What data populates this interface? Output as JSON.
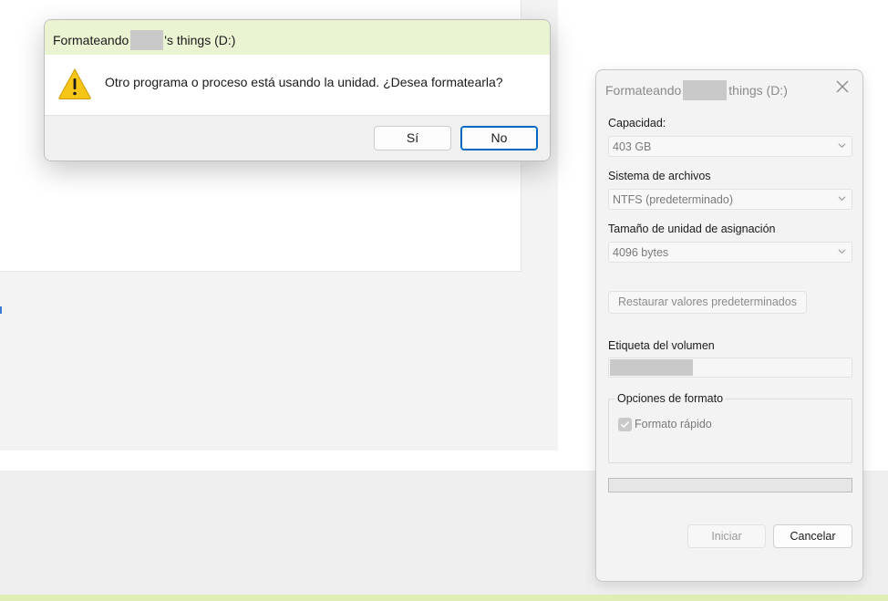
{
  "confirm_dialog": {
    "title_prefix": "Formateando",
    "title_suffix": "'s things (D:)",
    "message": "Otro programa o proceso está usando la unidad. ¿Desea formatearla?",
    "yes_label": "Sí",
    "no_label": "No",
    "icon": "warning-icon"
  },
  "format_dialog": {
    "title_prefix": "Formateando",
    "title_suffix": "things (D:)",
    "close_icon": "close-icon",
    "capacity_label": "Capacidad:",
    "capacity_value": "403 GB",
    "filesystem_label": "Sistema de archivos",
    "filesystem_value": "NTFS (predeterminado)",
    "allocation_label": "Tamaño de unidad de asignación",
    "allocation_value": "4096 bytes",
    "restore_label": "Restaurar valores predeterminados",
    "volume_label": "Etiqueta del volumen",
    "format_options_label": "Opciones de formato",
    "quick_format_label": "Formato rápido",
    "quick_format_checked": true,
    "start_label": "Iniciar",
    "cancel_label": "Cancelar",
    "progress": 0
  },
  "colors": {
    "title_bar_accent": "#eaf3d2",
    "focus_border": "#0067c0",
    "warning_yellow": "#f5c518"
  }
}
